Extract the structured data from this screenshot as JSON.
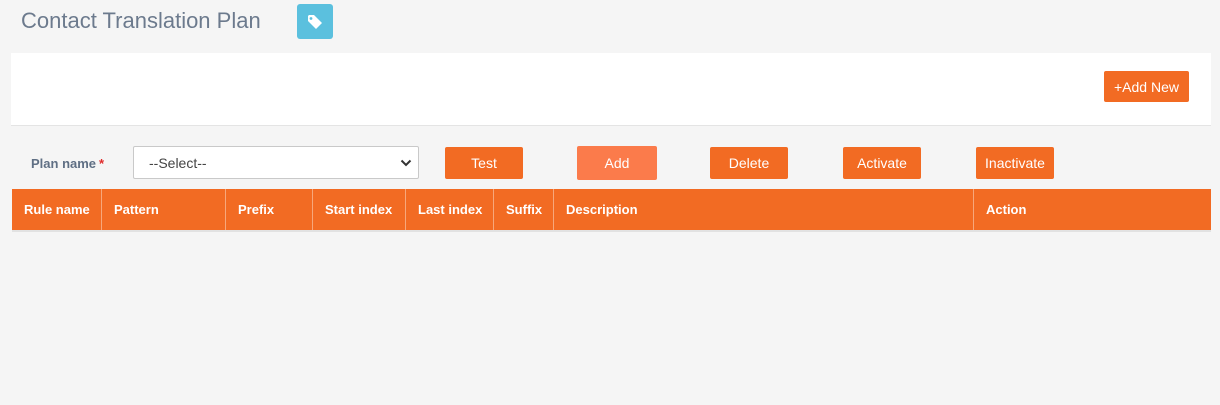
{
  "page": {
    "title": "Contact Translation Plan",
    "title_icon": "tag-icon"
  },
  "panel": {
    "add_new_label": "+Add New"
  },
  "form": {
    "plan_label": "Plan name",
    "required_marker": "*",
    "plan_select_value": "--Select--"
  },
  "actions": {
    "test": "Test",
    "add": "Add",
    "delete": "Delete",
    "activate": "Activate",
    "inactivate": "Inactivate"
  },
  "table": {
    "columns": [
      "Rule name",
      "Pattern",
      "Prefix",
      "Start index",
      "Last index",
      "Suffix",
      "Description",
      "Action"
    ]
  },
  "colors": {
    "accent": "#f26b23",
    "accent_light": "#fb7b4b",
    "title_icon_bg": "#5bc0de"
  }
}
